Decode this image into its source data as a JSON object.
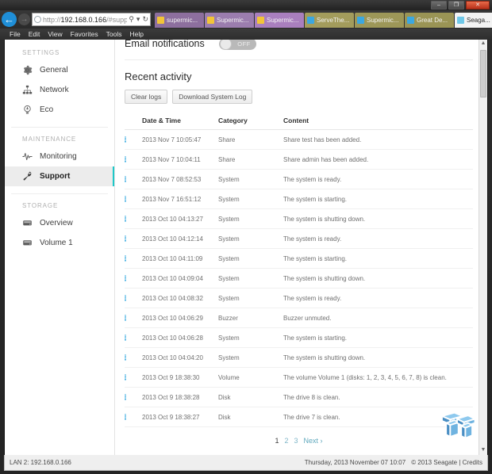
{
  "window": {
    "controls": {
      "minimize": "–",
      "maximize": "❐",
      "close": "✕"
    }
  },
  "browser": {
    "back_glyph": "←",
    "forward_glyph": "→",
    "address": {
      "scheme": "http://",
      "host": "192.168.0.166",
      "path": "/#support",
      "search_glyph": "⚲",
      "dropdown_glyph": "▾",
      "refresh_glyph": "↻"
    },
    "tabs": [
      {
        "label": "supermic...",
        "color": "#8d6f9e",
        "favicon": "#f2c438",
        "active": false
      },
      {
        "label": "Supermic...",
        "color": "#9b7dae",
        "favicon": "#f2c438",
        "active": false
      },
      {
        "label": "Supermic...",
        "color": "#a97fbe",
        "favicon": "#f2c438",
        "active": false
      },
      {
        "label": "ServeThe...",
        "color": "#a39c5c",
        "favicon": "#3ba7e0",
        "active": false
      },
      {
        "label": "Supermic...",
        "color": "#9d9758",
        "favicon": "#3ba7e0",
        "active": false
      },
      {
        "label": "Great De...",
        "color": "#9a9455",
        "favicon": "#3ba7e0",
        "active": false
      },
      {
        "label": "Seaga...",
        "color": "#f3f3f3",
        "favicon": "#6fc8e8",
        "active": true,
        "close_glyph": "✕"
      }
    ],
    "icons": [
      {
        "name": "home-icon",
        "glyph": "⌂"
      },
      {
        "name": "favorites-icon",
        "glyph": "★"
      },
      {
        "name": "tools-gear-icon",
        "glyph": "⚙"
      }
    ],
    "menu": [
      "File",
      "Edit",
      "View",
      "Favorites",
      "Tools",
      "Help"
    ]
  },
  "sidebar": {
    "groups": [
      {
        "title": "SETTINGS",
        "items": [
          {
            "label": "General",
            "icon": "gear-icon",
            "active": false
          },
          {
            "label": "Network",
            "icon": "network-icon",
            "active": false
          },
          {
            "label": "Eco",
            "icon": "eco-icon",
            "active": false
          }
        ]
      },
      {
        "title": "MAINTENANCE",
        "items": [
          {
            "label": "Monitoring",
            "icon": "pulse-icon",
            "active": false
          },
          {
            "label": "Support",
            "icon": "wrench-icon",
            "active": true
          }
        ]
      },
      {
        "title": "STORAGE",
        "items": [
          {
            "label": "Overview",
            "icon": "drive-icon",
            "active": false
          },
          {
            "label": "Volume 1",
            "icon": "drive-icon",
            "active": false
          }
        ]
      }
    ]
  },
  "main": {
    "email_notifications_label": "Email notifications",
    "email_notifications_state": "OFF",
    "recent_activity_title": "Recent activity",
    "buttons": {
      "clear_logs": "Clear logs",
      "download_log": "Download System Log"
    },
    "table": {
      "headers": [
        "Date & Time",
        "Category",
        "Content"
      ],
      "row_icon_glyph": "i",
      "rows": [
        {
          "datetime": "2013 Nov 7 10:05:47",
          "category": "Share",
          "content": "Share test has been added."
        },
        {
          "datetime": "2013 Nov 7 10:04:11",
          "category": "Share",
          "content": "Share admin has been added."
        },
        {
          "datetime": "2013 Nov 7 08:52:53",
          "category": "System",
          "content": "The system is ready."
        },
        {
          "datetime": "2013 Nov 7 16:51:12",
          "category": "System",
          "content": "The system is starting."
        },
        {
          "datetime": "2013 Oct 10 04:13:27",
          "category": "System",
          "content": "The system is shutting down."
        },
        {
          "datetime": "2013 Oct 10 04:12:14",
          "category": "System",
          "content": "The system is ready."
        },
        {
          "datetime": "2013 Oct 10 04:11:09",
          "category": "System",
          "content": "The system is starting."
        },
        {
          "datetime": "2013 Oct 10 04:09:04",
          "category": "System",
          "content": "The system is shutting down."
        },
        {
          "datetime": "2013 Oct 10 04:08:32",
          "category": "System",
          "content": "The system is ready."
        },
        {
          "datetime": "2013 Oct 10 04:06:29",
          "category": "Buzzer",
          "content": "Buzzer unmuted."
        },
        {
          "datetime": "2013 Oct 10 04:06:28",
          "category": "System",
          "content": "The system is starting."
        },
        {
          "datetime": "2013 Oct 10 04:04:20",
          "category": "System",
          "content": "The system is shutting down."
        },
        {
          "datetime": "2013 Oct 9 18:38:30",
          "category": "Volume",
          "content": "The volume Volume 1 (disks: 1, 2, 3, 4, 5, 6, 7, 8) is clean."
        },
        {
          "datetime": "2013 Oct 9 18:38:28",
          "category": "Disk",
          "content": "The drive 8 is clean."
        },
        {
          "datetime": "2013 Oct 9 18:38:27",
          "category": "Disk",
          "content": "The drive 7 is clean."
        }
      ]
    },
    "pagination": {
      "pages": [
        "1",
        "2",
        "3"
      ],
      "current": "1",
      "next_label": "Next",
      "next_glyph": "›"
    }
  },
  "statusbar": {
    "lan": "LAN 2: 192.168.0.166",
    "datetime": "Thursday, 2013 November 07   10:07",
    "copyright": "© 2013 Seagate | Credits"
  },
  "colors": {
    "accent": "#1ec8c8",
    "info": "#1fa0dc",
    "link": "#5fa8bd"
  }
}
